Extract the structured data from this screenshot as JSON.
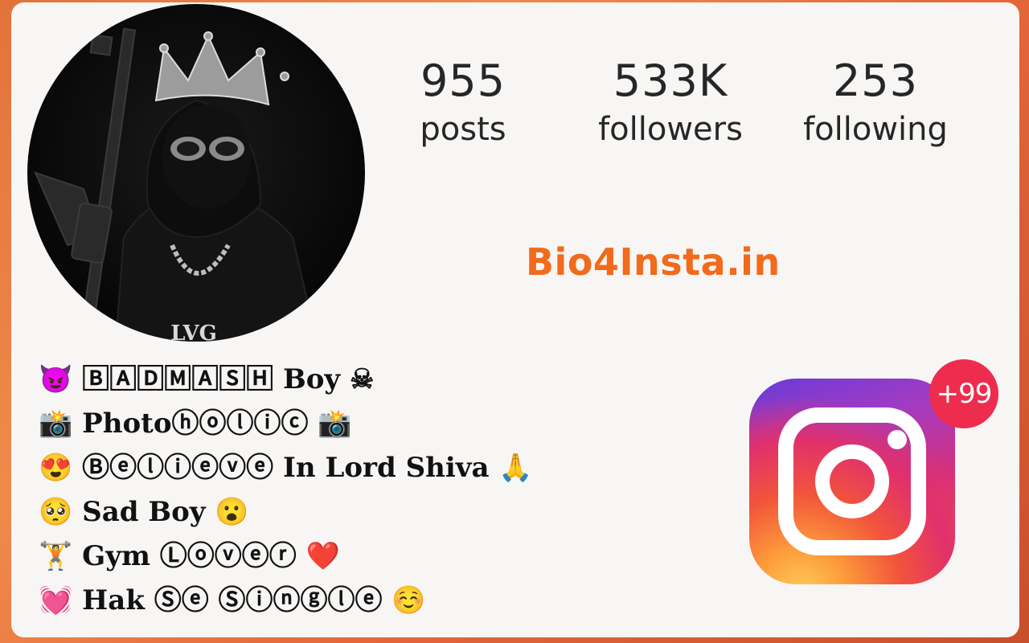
{
  "profile": {
    "stats": {
      "posts": {
        "value": "955",
        "label": "posts"
      },
      "followers": {
        "value": "533K",
        "label": "followers"
      },
      "following": {
        "value": "253",
        "label": "following"
      }
    },
    "watermark": "Bio4Insta.in",
    "avatar_chain_text": "LVG",
    "bio": [
      "😈 🄱🄰🄳🄼🄰🅂🄷 Boy ☠",
      "📸 Photoⓗⓞⓛⓘⓒ 📸",
      "😍 Ⓑⓔⓛⓘⓔⓥⓔ In Lord Shiva 🙏",
      "🥺 Sad Boy 😮",
      "🏋 Gym Ⓛⓞⓥⓔⓡ ❤️",
      "💓 Hak Ⓢⓔ Ⓢⓘⓝⓖⓛⓔ ☺️"
    ]
  },
  "instagram_badge": {
    "icon": "instagram-icon",
    "count": "+99",
    "colors": {
      "badge": "#ee2c4e",
      "accent": "#f26a1b"
    }
  }
}
